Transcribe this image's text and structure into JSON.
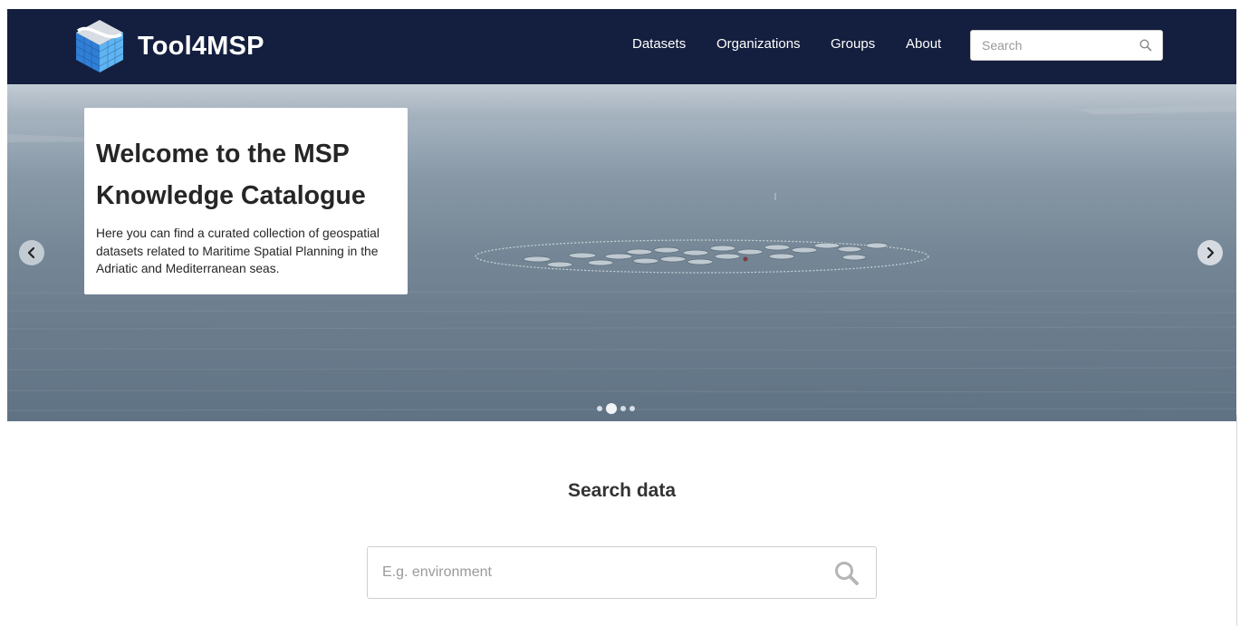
{
  "header": {
    "brand": "Tool4MSP",
    "nav": {
      "datasets": "Datasets",
      "organizations": "Organizations",
      "groups": "Groups",
      "about": "About"
    },
    "search_placeholder": "Search",
    "search_icon": "magnifier-icon",
    "colors": {
      "background": "#141f3f",
      "text": "#ffffff"
    }
  },
  "hero": {
    "title": "Welcome to the MSP Knowledge Catalogue",
    "description": "Here you can find a curated collection of geospatial datasets related to Maritime Spatial Planning in the Adriatic and Mediterranean seas.",
    "prev_icon": "chevron-left-icon",
    "next_icon": "chevron-right-icon",
    "slide_count": 4,
    "active_slide": 2
  },
  "search_section": {
    "title": "Search data",
    "placeholder": "E.g. environment",
    "search_icon": "magnifier-icon"
  }
}
